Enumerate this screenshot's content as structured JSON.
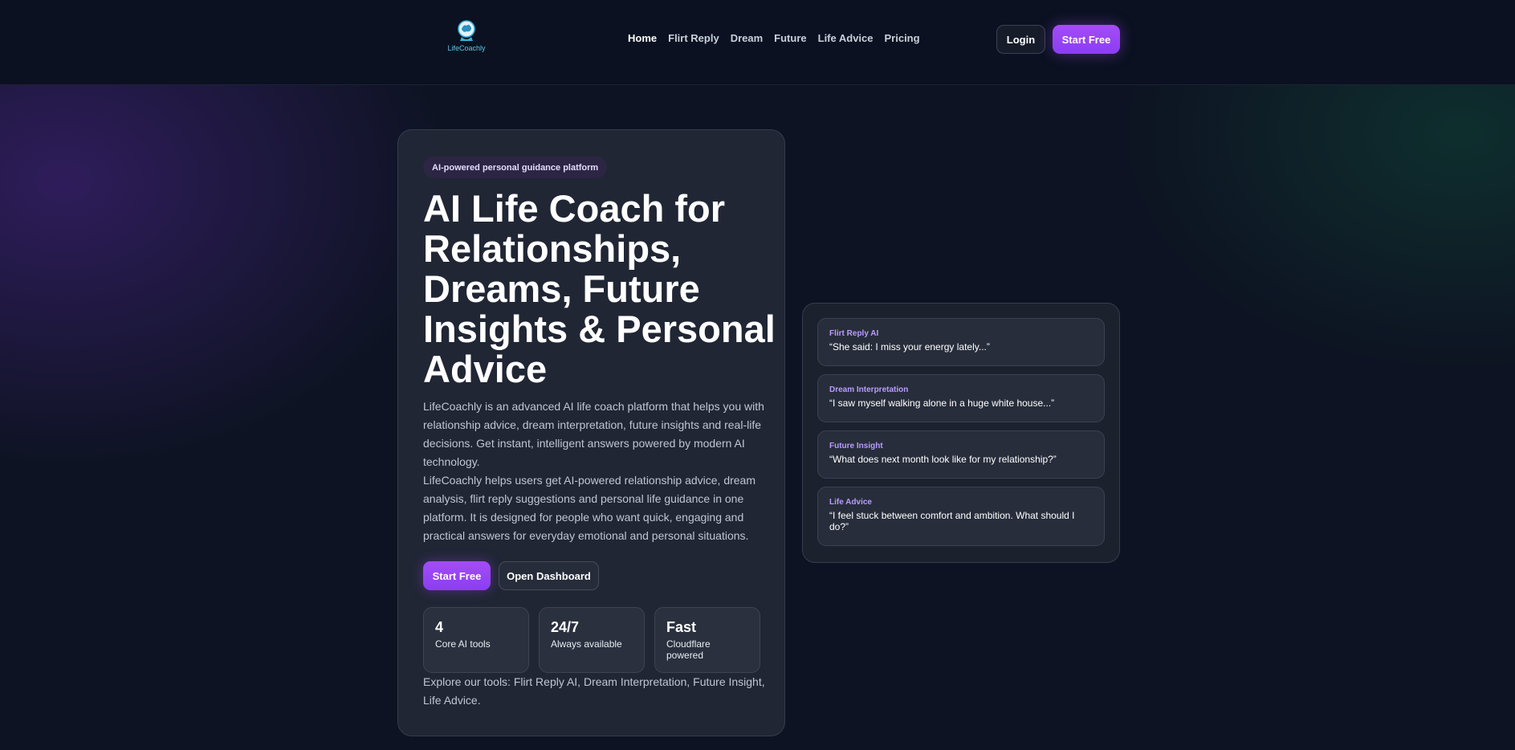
{
  "brand": {
    "logo_text": "LifeCoachly",
    "accent": "#9146f3",
    "logo_icon": "brain-head-icon"
  },
  "nav": {
    "items": [
      "Home",
      "Flirt Reply",
      "Dream",
      "Future",
      "Life Advice",
      "Pricing"
    ],
    "active": "Home"
  },
  "header": {
    "login_label": "Login",
    "start_label": "Start Free"
  },
  "hero": {
    "badge": "AI-powered personal guidance platform",
    "title": "AI Life Coach for Relationships, Dreams, Future Insights & Personal Advice",
    "description_1": "LifeCoachly is an advanced AI life coach platform that helps you with relationship advice, dream interpretation, future insights and real-life decisions. Get instant, intelligent answers powered by modern AI technology.",
    "description_2": "LifeCoachly helps users get AI-powered relationship advice, dream analysis, flirt reply suggestions and personal life guidance in one platform. It is designed for people who want quick, engaging and practical answers for everyday emotional and personal situations.",
    "primary_cta": "Start Free",
    "secondary_cta": "Open Dashboard",
    "stats": [
      {
        "value": "4",
        "label": "Core AI tools"
      },
      {
        "value": "24/7",
        "label": "Always available"
      },
      {
        "value": "Fast",
        "label": "Cloudflare powered"
      }
    ],
    "explore": "Explore our tools: Flirt Reply AI, Dream Interpretation, Future Insight, Life Advice."
  },
  "preview": {
    "cards": [
      {
        "title": "Flirt Reply AI",
        "text": "“She said: I miss your energy lately...”"
      },
      {
        "title": "Dream Interpretation",
        "text": "“I saw myself walking alone in a huge white house...”"
      },
      {
        "title": "Future Insight",
        "text": "“What does next month look like for my relationship?”"
      },
      {
        "title": "Life Advice",
        "text": "“I feel stuck between comfort and ambition. What should I do?”"
      }
    ]
  }
}
